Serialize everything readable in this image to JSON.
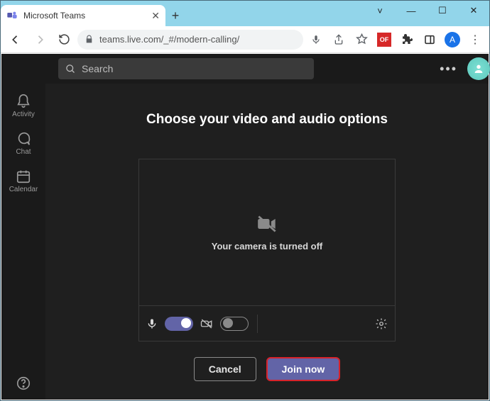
{
  "window": {
    "tab_title": "Microsoft Teams",
    "url": "teams.live.com/_#/modern-calling/"
  },
  "toolbar": {
    "ext_badge": "OF",
    "avatar_letter": "A"
  },
  "search": {
    "placeholder": "Search"
  },
  "rail": {
    "activity": "Activity",
    "chat": "Chat",
    "calendar": "Calendar"
  },
  "prejoin": {
    "heading": "Choose your video and audio options",
    "camera_off_msg": "Your camera is turned off",
    "cancel": "Cancel",
    "join": "Join now"
  }
}
